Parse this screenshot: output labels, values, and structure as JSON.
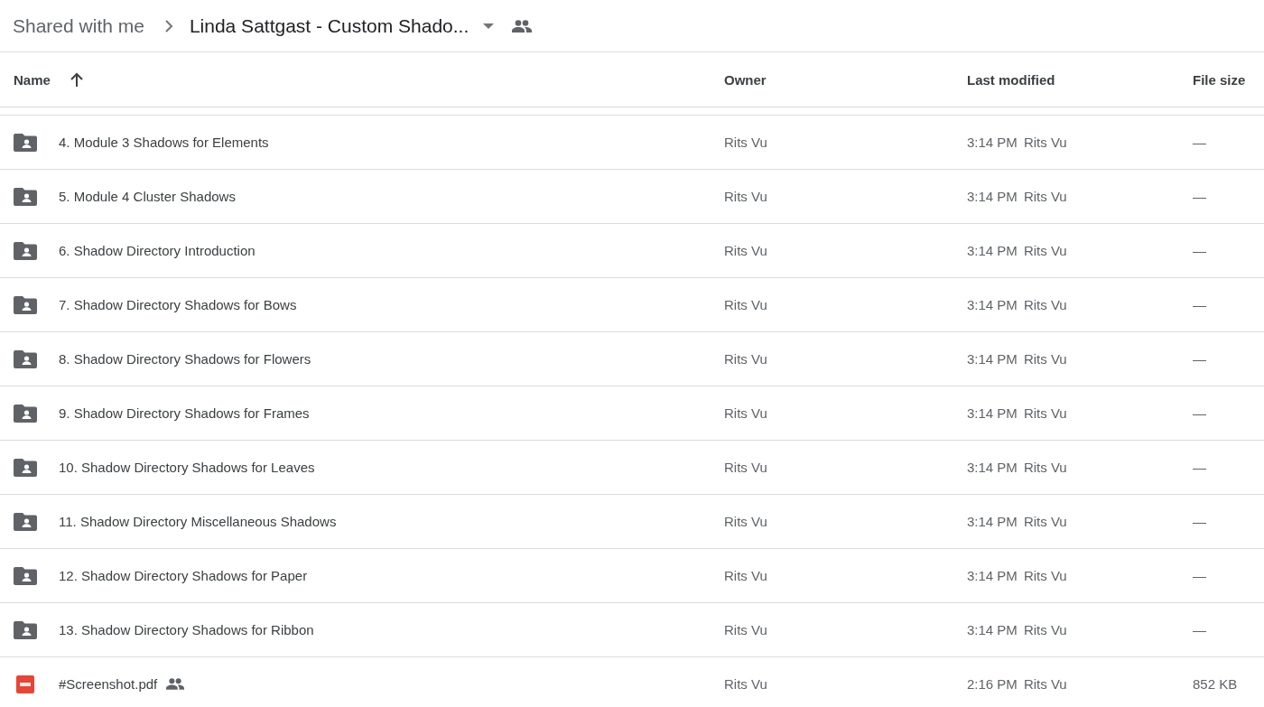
{
  "breadcrumb": {
    "parent": "Shared with me",
    "current": "Linda Sattgast - Custom Shado...",
    "current_shared": true
  },
  "columns": [
    {
      "label": "Name",
      "sorted": true
    },
    {
      "label": "Owner",
      "sorted": false
    },
    {
      "label": "Last modified",
      "sorted": false
    },
    {
      "label": "File size",
      "sorted": false
    }
  ],
  "rows": [
    {
      "kind": "folder",
      "name": "4. Module 3 Shadows for Elements",
      "shared": false,
      "owner": "Rits Vu",
      "time": "3:14 PM",
      "modified_by": "Rits Vu",
      "size": "—"
    },
    {
      "kind": "folder",
      "name": "5. Module 4 Cluster Shadows",
      "shared": false,
      "owner": "Rits Vu",
      "time": "3:14 PM",
      "modified_by": "Rits Vu",
      "size": "—"
    },
    {
      "kind": "folder",
      "name": "6. Shadow Directory Introduction",
      "shared": false,
      "owner": "Rits Vu",
      "time": "3:14 PM",
      "modified_by": "Rits Vu",
      "size": "—"
    },
    {
      "kind": "folder",
      "name": "7. Shadow Directory Shadows for Bows",
      "shared": false,
      "owner": "Rits Vu",
      "time": "3:14 PM",
      "modified_by": "Rits Vu",
      "size": "—"
    },
    {
      "kind": "folder",
      "name": "8. Shadow Directory Shadows for Flowers",
      "shared": false,
      "owner": "Rits Vu",
      "time": "3:14 PM",
      "modified_by": "Rits Vu",
      "size": "—"
    },
    {
      "kind": "folder",
      "name": "9. Shadow Directory Shadows for Frames",
      "shared": false,
      "owner": "Rits Vu",
      "time": "3:14 PM",
      "modified_by": "Rits Vu",
      "size": "—"
    },
    {
      "kind": "folder",
      "name": "10. Shadow Directory Shadows for Leaves",
      "shared": false,
      "owner": "Rits Vu",
      "time": "3:14 PM",
      "modified_by": "Rits Vu",
      "size": "—"
    },
    {
      "kind": "folder",
      "name": "11. Shadow Directory Miscellaneous Shadows",
      "shared": false,
      "owner": "Rits Vu",
      "time": "3:14 PM",
      "modified_by": "Rits Vu",
      "size": "—"
    },
    {
      "kind": "folder",
      "name": "12. Shadow Directory Shadows for Paper",
      "shared": false,
      "owner": "Rits Vu",
      "time": "3:14 PM",
      "modified_by": "Rits Vu",
      "size": "—"
    },
    {
      "kind": "folder",
      "name": "13. Shadow Directory Shadows for Ribbon",
      "shared": false,
      "owner": "Rits Vu",
      "time": "3:14 PM",
      "modified_by": "Rits Vu",
      "size": "—"
    },
    {
      "kind": "pdf",
      "name": "#Screenshot.pdf",
      "shared": true,
      "owner": "Rits Vu",
      "time": "2:16 PM",
      "modified_by": "Rits Vu",
      "size": "852 KB"
    }
  ]
}
